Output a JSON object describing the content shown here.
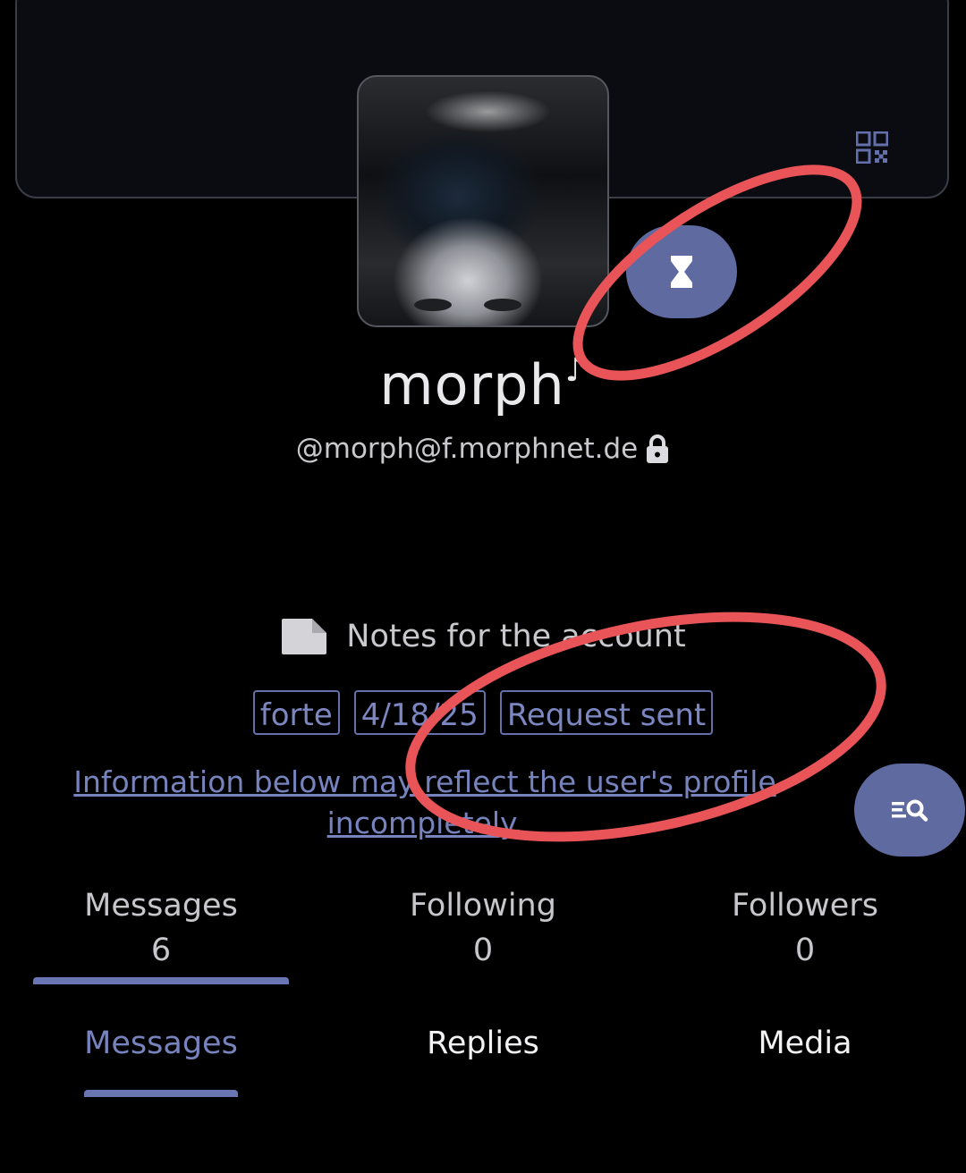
{
  "profile": {
    "display_name": "morph",
    "name_suffix": "♪",
    "handle": "@morph@f.morphnet.de"
  },
  "notes": {
    "label": "Notes for the account"
  },
  "tags": [
    "forte",
    "4/18/25",
    "Request sent"
  ],
  "info_notice": "Information below may reflect the user's profile incompletely.",
  "stats": [
    {
      "label": "Messages",
      "value": "6"
    },
    {
      "label": "Following",
      "value": "0"
    },
    {
      "label": "Followers",
      "value": "0"
    }
  ],
  "tabs": [
    {
      "label": "Messages"
    },
    {
      "label": "Replies"
    },
    {
      "label": "Media"
    }
  ],
  "icons": {
    "qr": "qr-code-icon",
    "pending": "hourglass-icon",
    "lock": "lock-icon",
    "note": "note-icon",
    "search": "list-search-icon"
  },
  "colors": {
    "accent": "#5e6aa0",
    "link": "#7783bd",
    "annotation": "#e85457"
  }
}
